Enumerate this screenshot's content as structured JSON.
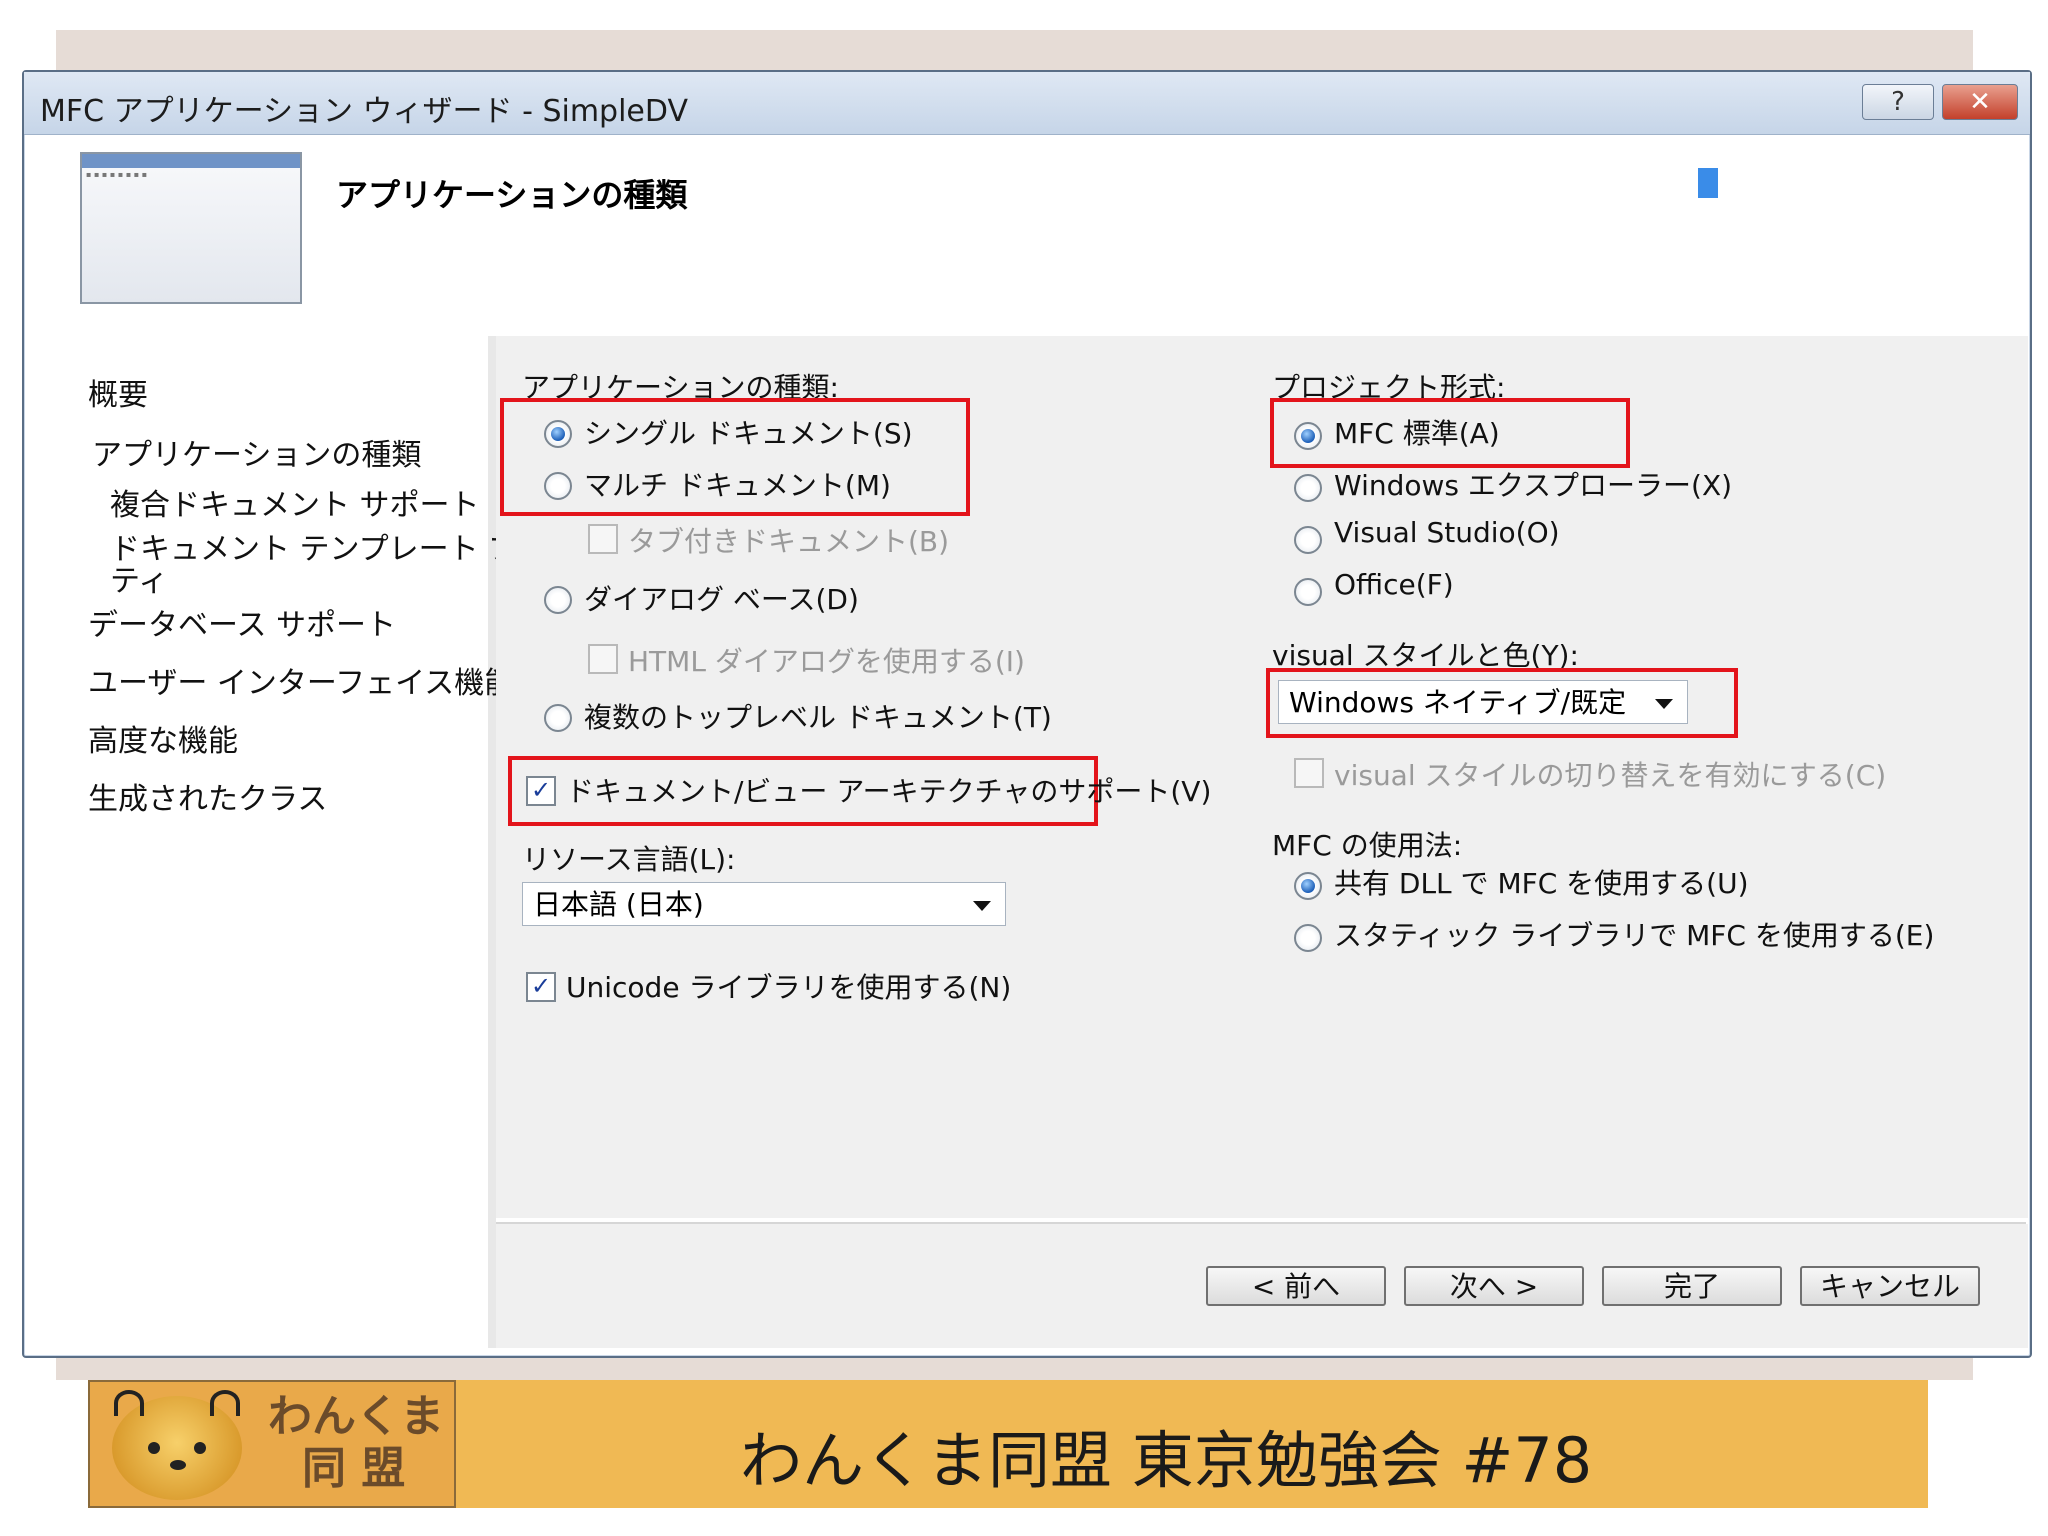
{
  "window": {
    "title": "MFC アプリケーション ウィザード - SimpleDV",
    "help_label": "?",
    "close_label": "✕"
  },
  "header": {
    "title": "アプリケーションの種類"
  },
  "nav": {
    "items": [
      "概要",
      "アプリケーションの種類",
      "複合ドキュメント サポート",
      "ドキュメント テンプレート プロパ",
      "ティ",
      "データベース サポート",
      "ユーザー インターフェイス機能",
      "高度な機能",
      "生成されたクラス"
    ]
  },
  "app_type": {
    "label": "アプリケーションの種類:",
    "single_doc": "シングル ドキュメント(S)",
    "multi_doc": "マルチ ドキュメント(M)",
    "tabbed_doc": "タブ付きドキュメント(B)",
    "dialog_based": "ダイアログ ベース(D)",
    "html_dialog": "HTML ダイアログを使用する(I)",
    "multi_toplevel": "複数のトップレベル ドキュメント(T)",
    "doc_view": "ドキュメント/ビュー アーキテクチャのサポート(V)",
    "resource_lang_label": "リソース言語(L):",
    "resource_lang_value": "日本語 (日本)",
    "unicode": "Unicode ライブラリを使用する(N)"
  },
  "project_style": {
    "label": "プロジェクト形式:",
    "mfc_standard": "MFC 標準(A)",
    "windows_explorer": "Windows エクスプローラー(X)",
    "visual_studio": "Visual Studio(O)",
    "office": "Office(F)",
    "visual_style_label": "visual スタイルと色(Y):",
    "visual_style_value": "Windows ネイティブ/既定",
    "enable_switch": "visual スタイルの切り替えを有効にする(C)",
    "mfc_usage_label": "MFC の使用法:",
    "shared_dll": "共有 DLL で MFC を使用する(U)",
    "static_lib": "スタティック ライブラリで MFC を使用する(E)"
  },
  "buttons": {
    "prev": "< 前へ",
    "next": "次へ >",
    "finish": "完了",
    "cancel": "キャンセル"
  },
  "footer": {
    "logo_line1": "わんくま",
    "logo_line2": "同 盟",
    "title": "わんくま同盟 東京勉強会 #78"
  },
  "colors": {
    "highlight_box": "#e3141b",
    "footer_bg": "#f0b954"
  }
}
